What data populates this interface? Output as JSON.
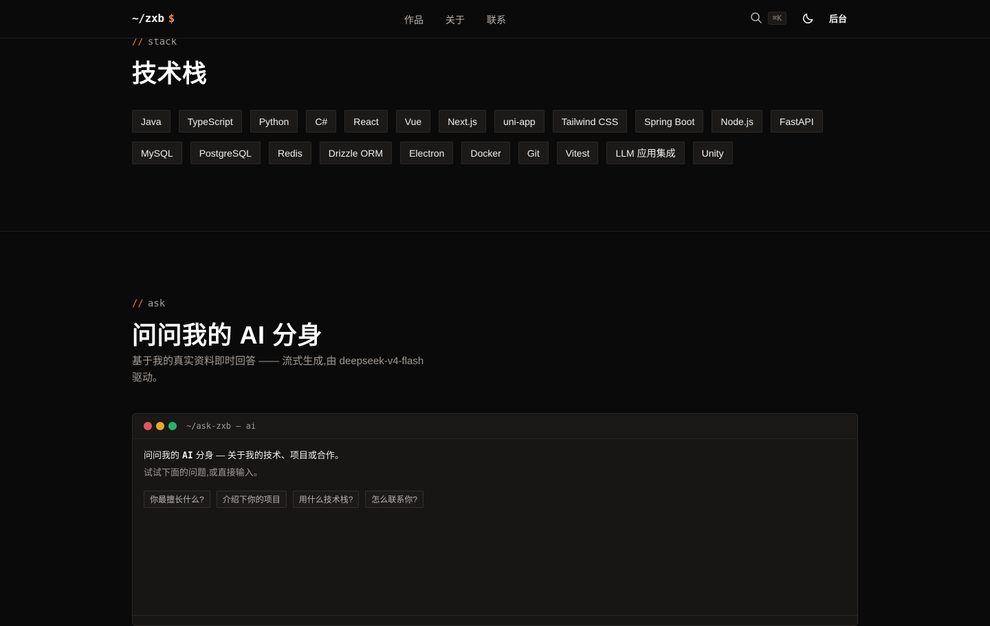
{
  "header": {
    "logo": "~/zxb",
    "logo_suffix": "$",
    "nav": [
      "作品",
      "关于",
      "联系"
    ],
    "shortcut": "⌘K",
    "admin": "后台"
  },
  "stack": {
    "eyebrow_slash": "//",
    "eyebrow": "stack",
    "title": "技术栈",
    "tags": [
      "Java",
      "TypeScript",
      "Python",
      "C#",
      "React",
      "Vue",
      "Next.js",
      "uni-app",
      "Tailwind CSS",
      "Spring Boot",
      "Node.js",
      "FastAPI",
      "MySQL",
      "PostgreSQL",
      "Redis",
      "Drizzle ORM",
      "Electron",
      "Docker",
      "Git",
      "Vitest",
      "LLM 应用集成",
      "Unity"
    ]
  },
  "ask": {
    "eyebrow_slash": "//",
    "eyebrow": "ask",
    "title": "问问我的 AI 分身",
    "desc": "基于我的真实资料即时回答 —— 流式生成,由 deepseek-v4-flash 驱动。"
  },
  "terminal": {
    "title": "~/ask-zxb — ai",
    "dots": [
      "#e0575b",
      "#e3a92c",
      "#27b46a"
    ],
    "line1_a": "问问我的",
    "line1_ai": "AI",
    "line1_b": "分身 — 关于我的技术、项目或合作。",
    "line2": "试试下面的问题,或直接输入。",
    "suggestions": [
      "你最擅长什么?",
      "介绍下你的项目",
      "用什么技术栈?",
      "怎么联系你?"
    ]
  }
}
